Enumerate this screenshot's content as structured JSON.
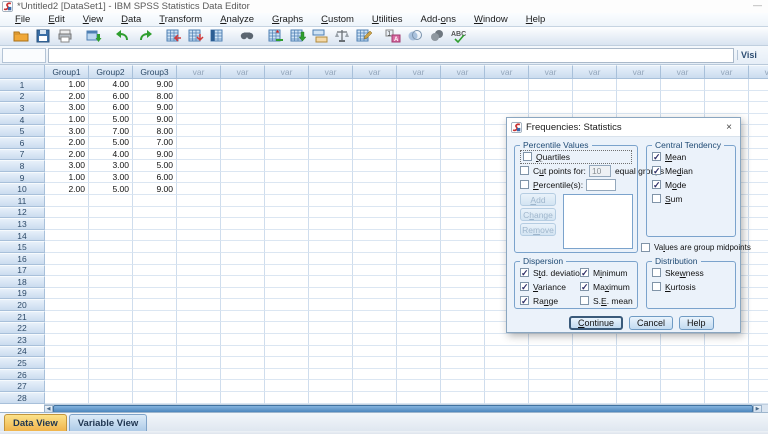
{
  "window": {
    "title": "*Untitled2 [DataSet1] - IBM SPSS Statistics Data Editor",
    "minimize_glyph": "—"
  },
  "menu": {
    "items": [
      {
        "label": "File",
        "u": 0
      },
      {
        "label": "Edit",
        "u": 0
      },
      {
        "label": "View",
        "u": 0
      },
      {
        "label": "Data",
        "u": 0
      },
      {
        "label": "Transform",
        "u": 0
      },
      {
        "label": "Analyze",
        "u": 0
      },
      {
        "label": "Graphs",
        "u": 0
      },
      {
        "label": "Custom",
        "u": 0
      },
      {
        "label": "Utilities",
        "u": 0
      },
      {
        "label": "Add-ons",
        "u": 4
      },
      {
        "label": "Window",
        "u": 0
      },
      {
        "label": "Help",
        "u": 0
      }
    ]
  },
  "toolbar": {
    "icons": [
      {
        "name": "open-data-icon",
        "group": true
      },
      {
        "name": "save-icon"
      },
      {
        "name": "print-icon"
      },
      {
        "name": "recall-dialogs-icon",
        "group": true
      },
      {
        "name": "undo-icon",
        "group": true
      },
      {
        "name": "redo-icon"
      },
      {
        "name": "goto-case-icon",
        "group": true
      },
      {
        "name": "goto-variable-icon"
      },
      {
        "name": "variables-icon"
      },
      {
        "name": "find-icon",
        "group": true
      },
      {
        "name": "insert-cases-icon",
        "group": true
      },
      {
        "name": "insert-variable-icon"
      },
      {
        "name": "split-file-icon"
      },
      {
        "name": "weight-cases-icon"
      },
      {
        "name": "select-cases-icon"
      },
      {
        "name": "value-labels-icon",
        "group": true
      },
      {
        "name": "use-variable-sets-icon"
      },
      {
        "name": "show-all-variables-icon"
      },
      {
        "name": "spell-check-icon"
      }
    ]
  },
  "edit_row": {
    "cell_reference": "",
    "editor_value": "",
    "right_label": "Visi"
  },
  "grid": {
    "columns": [
      "Group1",
      "Group2",
      "Group3",
      "var",
      "var",
      "var",
      "var",
      "var",
      "var",
      "var",
      "var",
      "var",
      "var",
      "var",
      "var",
      "var",
      "var"
    ],
    "total_rows": 28,
    "rows": [
      {
        "num": "1",
        "cells": [
          "1.00",
          "4.00",
          "9.00"
        ]
      },
      {
        "num": "2",
        "cells": [
          "2.00",
          "6.00",
          "8.00"
        ]
      },
      {
        "num": "3",
        "cells": [
          "3.00",
          "6.00",
          "9.00"
        ]
      },
      {
        "num": "4",
        "cells": [
          "1.00",
          "5.00",
          "9.00"
        ]
      },
      {
        "num": "5",
        "cells": [
          "3.00",
          "7.00",
          "8.00"
        ]
      },
      {
        "num": "6",
        "cells": [
          "2.00",
          "5.00",
          "7.00"
        ]
      },
      {
        "num": "7",
        "cells": [
          "2.00",
          "4.00",
          "9.00"
        ]
      },
      {
        "num": "8",
        "cells": [
          "3.00",
          "3.00",
          "5.00"
        ]
      },
      {
        "num": "9",
        "cells": [
          "1.00",
          "3.00",
          "6.00"
        ]
      },
      {
        "num": "10",
        "cells": [
          "2.00",
          "5.00",
          "9.00"
        ]
      }
    ]
  },
  "tabs": {
    "items": [
      {
        "label": "Data View",
        "active": true
      },
      {
        "label": "Variable View",
        "active": false
      }
    ]
  },
  "dialog": {
    "title": "Frequencies: Statistics",
    "close_glyph": "×",
    "percentile": {
      "title": "Percentile Values",
      "quartiles": {
        "label": "Quartiles",
        "checked": false,
        "u": 0
      },
      "cut_points": {
        "label": "Cut points for:",
        "checked": false,
        "u": 1,
        "value": "10",
        "suffix": "equal groups"
      },
      "percentiles": {
        "label": "Percentile(s):",
        "checked": false,
        "u": 0,
        "value": ""
      },
      "buttons": [
        {
          "label": "Add",
          "u": 0
        },
        {
          "label": "Change",
          "u": 1
        },
        {
          "label": "Remove",
          "u": 2
        }
      ]
    },
    "central_tendency": {
      "title": "Central Tendency",
      "items": [
        {
          "label": "Mean",
          "checked": true,
          "u": 0
        },
        {
          "label": "Median",
          "checked": true,
          "u": 2
        },
        {
          "label": "Mode",
          "checked": true,
          "u": 1
        },
        {
          "label": "Sum",
          "checked": false,
          "u": 0
        }
      ]
    },
    "midpoints": {
      "label": "Values are group midpoints",
      "checked": false,
      "u": 2
    },
    "dispersion": {
      "title": "Dispersion",
      "col1": [
        {
          "label": "Std. deviation",
          "checked": true,
          "u": 1
        },
        {
          "label": "Variance",
          "checked": true,
          "u": 0
        },
        {
          "label": "Range",
          "checked": true,
          "u": 2
        }
      ],
      "col2": [
        {
          "label": "Minimum",
          "checked": true,
          "u": 1
        },
        {
          "label": "Maximum",
          "checked": true,
          "u": 2
        },
        {
          "label": "S.E. mean",
          "checked": false,
          "u": 2
        }
      ]
    },
    "distribution": {
      "title": "Distribution",
      "items": [
        {
          "label": "Skewness",
          "checked": false,
          "u": 3
        },
        {
          "label": "Kurtosis",
          "checked": false,
          "u": 0
        }
      ]
    },
    "buttons": [
      {
        "label": "Continue",
        "u": 0,
        "default": true
      },
      {
        "label": "Cancel"
      },
      {
        "label": "Help"
      }
    ]
  },
  "colors": {
    "toolbar_bg": "#d9e4f1",
    "header_cell": "#cbdcef",
    "grid_line": "#cfdded",
    "active_tab": "#f0b44c",
    "inactive_tab": "#aecbe8",
    "dialog_bg": "#ebf2fa",
    "groupbox_border": "#7ba3cc",
    "check_color": "#2d2d66",
    "scroll_thumb": "#4c86bd"
  }
}
